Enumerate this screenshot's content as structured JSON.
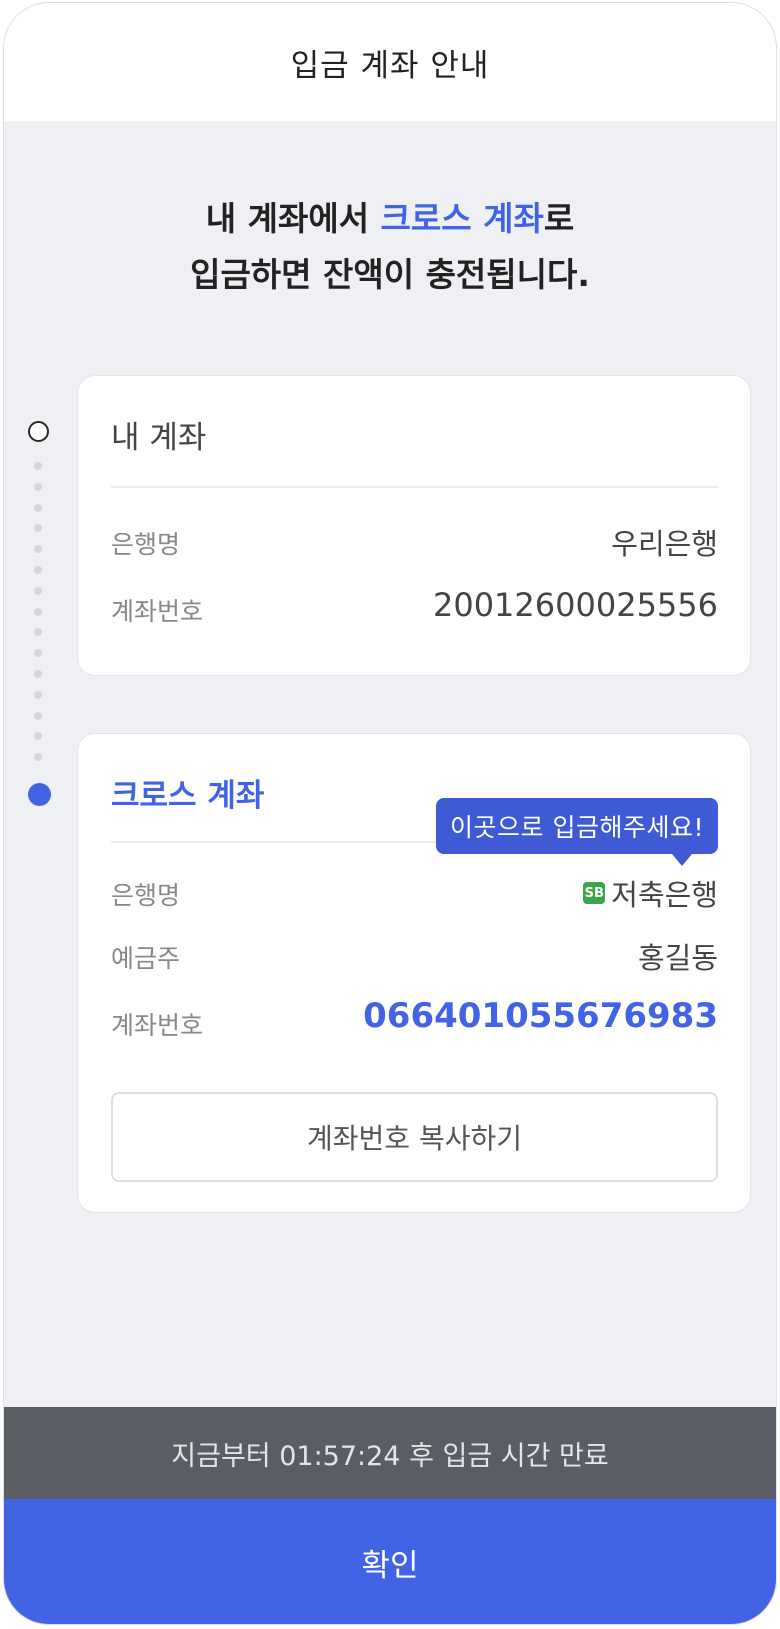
{
  "header": {
    "title": "입금 계좌 안내"
  },
  "headline": {
    "line1_pre": "내 계좌에서 ",
    "line1_accent": "크로스 계좌",
    "line1_post": "로",
    "line2": "입금하면 잔액이 충전됩니다."
  },
  "my_account": {
    "title": "내 계좌",
    "bank_label": "은행명",
    "bank_value": "우리은행",
    "number_label": "계좌번호",
    "number_value": "20012600025556"
  },
  "cross_account": {
    "title": "크로스 계좌",
    "tooltip": "이곳으로 입금해주세요!",
    "bank_label": "은행명",
    "bank_logo_text": "SB",
    "bank_value": "저축은행",
    "holder_label": "예금주",
    "holder_value": "홍길동",
    "number_label": "계좌번호",
    "number_value": "066401055676983",
    "copy_button": "계좌번호 복사하기"
  },
  "timer": {
    "text": "지금부터 01:57:24 후 입금 시간 만료"
  },
  "confirm": {
    "label": "확인"
  },
  "colors": {
    "accent": "#4263e4",
    "timer_bg": "#5b5d64",
    "bank_logo": "#3aa54a"
  }
}
